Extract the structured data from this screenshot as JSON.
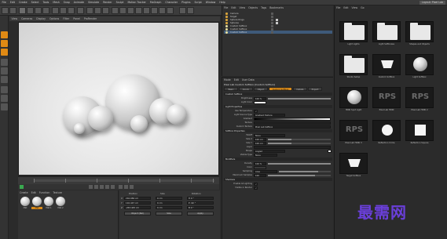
{
  "menubar": {
    "items": [
      "File",
      "Edit",
      "Create",
      "Select",
      "Tools",
      "Mesh",
      "Snap",
      "Animate",
      "Simulate",
      "Render",
      "Sculpt",
      "Motion Tracker",
      "MoGraph",
      "Character",
      "Plugins",
      "Script",
      "Window",
      "Help"
    ],
    "layout_label": "Layout:",
    "layout_value": "Pixel Lab"
  },
  "viewport": {
    "menu": [
      "View",
      "Cameras",
      "Display",
      "Options",
      "Filter",
      "Panel",
      "ProRender"
    ]
  },
  "object_manager": {
    "menu": [
      "File",
      "Edit",
      "View",
      "Objects",
      "Tags",
      "Bookmarks"
    ],
    "objects": [
      {
        "name": "Camera"
      },
      {
        "name": "Target"
      },
      {
        "name": "Sphere Rings"
      },
      {
        "name": "Spheres"
      },
      {
        "name": "Custom Softbox"
      },
      {
        "name": "Custom Softbox"
      },
      {
        "name": "Custom Softbox"
      }
    ]
  },
  "attribute_manager": {
    "menu": [
      "Mode",
      "Edit",
      "User Data"
    ],
    "title": "Pixel Lab Custom Softbox [Custom Softbox]",
    "tabs": [
      "Basic",
      "Coord.",
      "Object",
      "Custom Softbox",
      "Details",
      "Project"
    ],
    "active_tab": "Custom Softbox",
    "sections": [
      "Custom Softbox",
      "Light Properties",
      "Softbox Properties",
      "Modifiers",
      "Shadows"
    ],
    "props": [
      {
        "label": "Brightness",
        "value": "100 %"
      },
      {
        "label": "Light Color",
        "value": ""
      },
      {
        "label": "Use Temperature",
        "value": "✓"
      },
      {
        "label": "Light Source Type",
        "value": "Gradient Texture"
      },
      {
        "label": "Gradient",
        "value": ""
      },
      {
        "label": "Texture",
        "value": ""
      },
      {
        "label": "Custom Texture",
        "value": "Pixel Lab Softbox"
      },
      {
        "label": "Falloff",
        "value": "None"
      },
      {
        "label": "Size X",
        "value": "100 cm"
      },
      {
        "label": "Size Y",
        "value": "100 cm"
      },
      {
        "label": "Layer",
        "value": ""
      },
      {
        "label": "Shape",
        "value": "Angled"
      },
      {
        "label": "Visible Type",
        "value": "None"
      },
      {
        "label": "Density",
        "value": "100 %"
      },
      {
        "label": "Color",
        "value": ""
      },
      {
        "label": "Sampling",
        "value": "Area"
      },
      {
        "label": "Maximum Samples",
        "value": "100"
      },
      {
        "label": "Enable Gl Lighting",
        "value": "✓"
      },
      {
        "label": "Visible in Render",
        "value": "✓"
      }
    ]
  },
  "material_manager": {
    "menu": [
      "Create",
      "Edit",
      "Function",
      "Texture"
    ],
    "materials": [
      "Mat",
      "Mat",
      "Mat.1",
      "Mat.2"
    ],
    "selected_index": 1
  },
  "coordinates": {
    "headers": [
      "Position",
      "Size",
      "Rotation"
    ],
    "rows": [
      {
        "axis": "X",
        "pos": "216.984 cm",
        "size": "0 cm",
        "rot": "H 0 °"
      },
      {
        "axis": "Y",
        "pos": "110.447 cm",
        "size": "0 cm",
        "rot": "P -90 °"
      },
      {
        "axis": "Z",
        "pos": "-263.405 cm",
        "size": "0 cm",
        "rot": "B 0 °"
      }
    ],
    "mode": "Object (Rel)",
    "size_mode": "Size",
    "apply": "Apply"
  },
  "content_browser": {
    "menu": [
      "File",
      "Edit",
      "View",
      "Go"
    ],
    "tiles": [
      {
        "label": "Light Lights",
        "kind": "folder"
      },
      {
        "label": "Light Softboxes",
        "kind": "folder"
      },
      {
        "label": "Shapes and Objects",
        "kind": "folder"
      },
      {
        "label": "Studio Setup",
        "kind": "folder"
      },
      {
        "label": "Custom Softbox",
        "kind": "softbox"
      },
      {
        "label": "Light Softbox",
        "kind": "ball"
      },
      {
        "label": "HDRI Spot Light",
        "kind": "ball"
      },
      {
        "label": "Pixel Lab HDRI",
        "kind": "rps"
      },
      {
        "label": "Pixel Lab HDRI 2",
        "kind": "rps"
      },
      {
        "label": "Pixel Lab HDRI 3",
        "kind": "rps"
      },
      {
        "label": "Reflection Circle",
        "kind": "circle"
      },
      {
        "label": "Reflection Square",
        "kind": "square"
      },
      {
        "label": "Target Softbox",
        "kind": "softbox"
      }
    ]
  },
  "watermark": "最需网"
}
